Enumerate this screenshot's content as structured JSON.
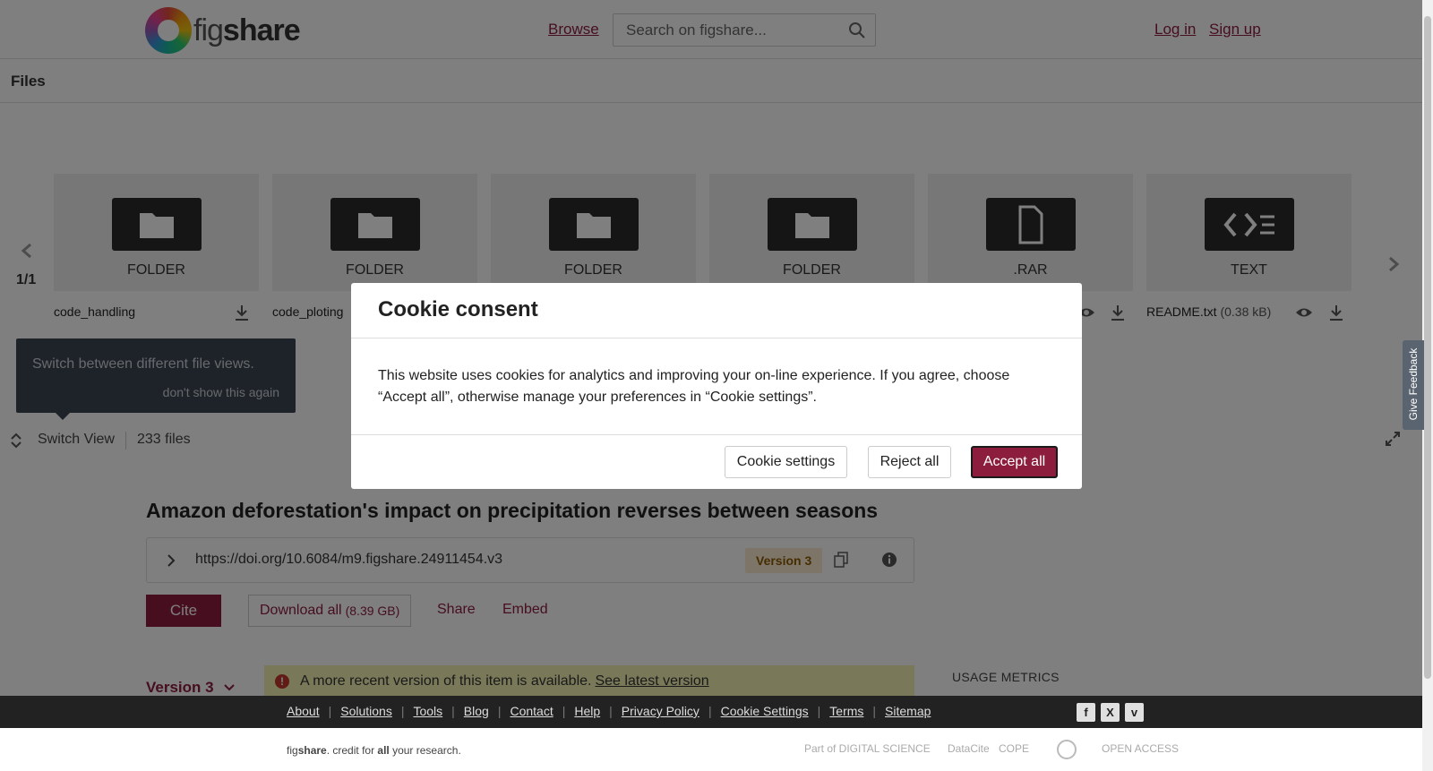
{
  "header": {
    "logo_text_a": "fig",
    "logo_text_b": "share",
    "browse": "Browse",
    "search_placeholder": "Search on figshare...",
    "login": "Log in",
    "signup": "Sign up"
  },
  "files": {
    "title": "Files",
    "page_counter": "1/1",
    "tiles": [
      {
        "type": "FOLDER",
        "name": "code_handling",
        "size": ""
      },
      {
        "type": "FOLDER",
        "name": "code_ploting",
        "size": ""
      },
      {
        "type": "FOLDER",
        "name": "",
        "size": ""
      },
      {
        "type": "FOLDER",
        "name": "",
        "size": ""
      },
      {
        "type": ".RAR",
        "name": "",
        "size": ""
      },
      {
        "type": "TEXT",
        "name": "README.txt",
        "size": "(0.38 kB)"
      }
    ],
    "tooltip_text": "Switch between different file views.",
    "tooltip_dismiss": "don't show this again",
    "switch_view": "Switch View",
    "file_count": "233 files"
  },
  "item": {
    "title": "Amazon deforestation's impact on precipitation reverses between seasons",
    "doi": "https://doi.org/10.6084/m9.figshare.24911454.v3",
    "version_pill": "Version 3",
    "cite": "Cite",
    "download_all": "Download all",
    "download_size": "(8.39 GB)",
    "share": "Share",
    "embed": "Embed",
    "version_toggle": "Version 3",
    "notice_text": "A more recent version of this item is available.",
    "notice_link": "See latest version",
    "usage_metrics": "USAGE METRICS"
  },
  "cookie": {
    "title": "Cookie consent",
    "body": "This website uses cookies for analytics and improving your on-line experience. If you agree, choose “Accept all”, otherwise manage your preferences in “Cookie settings”.",
    "settings": "Cookie settings",
    "reject": "Reject all",
    "accept": "Accept all"
  },
  "footer": {
    "links": [
      "About",
      "Solutions",
      "Tools",
      "Blog",
      "Contact",
      "Help",
      "Privacy Policy",
      "Cookie Settings",
      "Terms",
      "Sitemap"
    ],
    "tagline_a": "fig",
    "tagline_b": "share",
    "tagline_c": ". credit for ",
    "tagline_d": "all",
    "tagline_e": " your research.",
    "partner_ds": "Part of DIGITAL SCIENCE",
    "partner_datacite": "DataCite",
    "partner_cope": "COPE",
    "partner_oa": "OPEN ACCESS",
    "social": [
      "f",
      "X",
      "v"
    ]
  },
  "feedback": "Give Feedback",
  "colors": {
    "brand": "#8c1d3c",
    "notice_bg": "#f2f3b5",
    "footer_bg": "#222222"
  }
}
